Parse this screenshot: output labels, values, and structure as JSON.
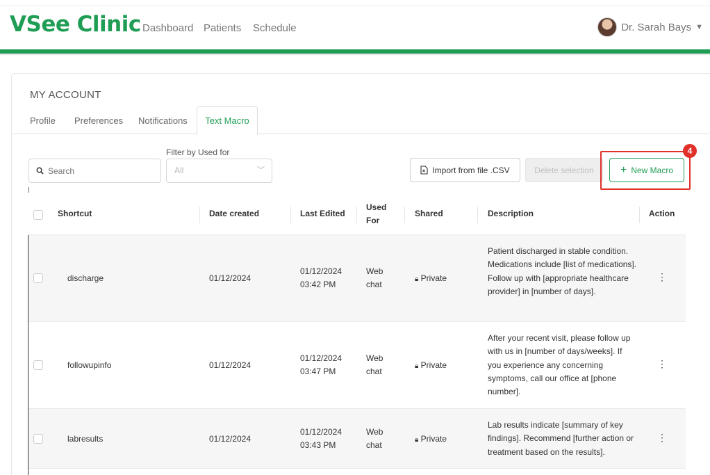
{
  "brand": "VSee Clinic",
  "nav": [
    "Dashboard",
    "Patients",
    "Schedule"
  ],
  "user": {
    "name": "Dr. Sarah Bays"
  },
  "account_title": "MY ACCOUNT",
  "tabs": [
    "Profile",
    "Preferences",
    "Notifications",
    "Text Macro"
  ],
  "active_tab": "Text Macro",
  "search": {
    "placeholder": "Search"
  },
  "filter": {
    "label": "Filter by Used for",
    "value": "All"
  },
  "buttons": {
    "import": "Import from file .CSV",
    "delete": "Delete selection",
    "new": "New Macro"
  },
  "annotation_badge": "4",
  "table": {
    "headers": {
      "shortcut": "Shortcut",
      "date_created": "Date created",
      "last_edited": "Last Edited",
      "used_for_1": "Used",
      "used_for_2": "For",
      "shared": "Shared",
      "description": "Description",
      "action": "Action"
    },
    "rows": [
      {
        "shortcut": "discharge",
        "date_created": "01/12/2024",
        "edited_date": "01/12/2024",
        "edited_time": "03:42 PM",
        "used_1": "Web",
        "used_2": "chat",
        "shared": "Private",
        "description": "Patient discharged in stable condition. Medications include [list of medications]. Follow up with [appropriate healthcare provider] in [number of days]."
      },
      {
        "shortcut": "followupinfo",
        "date_created": "01/12/2024",
        "edited_date": "01/12/2024",
        "edited_time": "03:47 PM",
        "used_1": "Web",
        "used_2": "chat",
        "shared": "Private",
        "description": "After your recent visit, please follow up with us in [number of days/weeks]. If you experience any concerning symptoms, call our office at [phone number]."
      },
      {
        "shortcut": "labresults",
        "date_created": "01/12/2024",
        "edited_date": "01/12/2024",
        "edited_time": "03:43 PM",
        "used_1": "Web",
        "used_2": "chat",
        "shared": "Private",
        "description": "Lab results indicate [summary of key findings]. Recommend [further action or treatment based on the results]."
      }
    ]
  },
  "colors": {
    "brand_green": "#1f9d55",
    "highlight_red": "#e0302a"
  }
}
